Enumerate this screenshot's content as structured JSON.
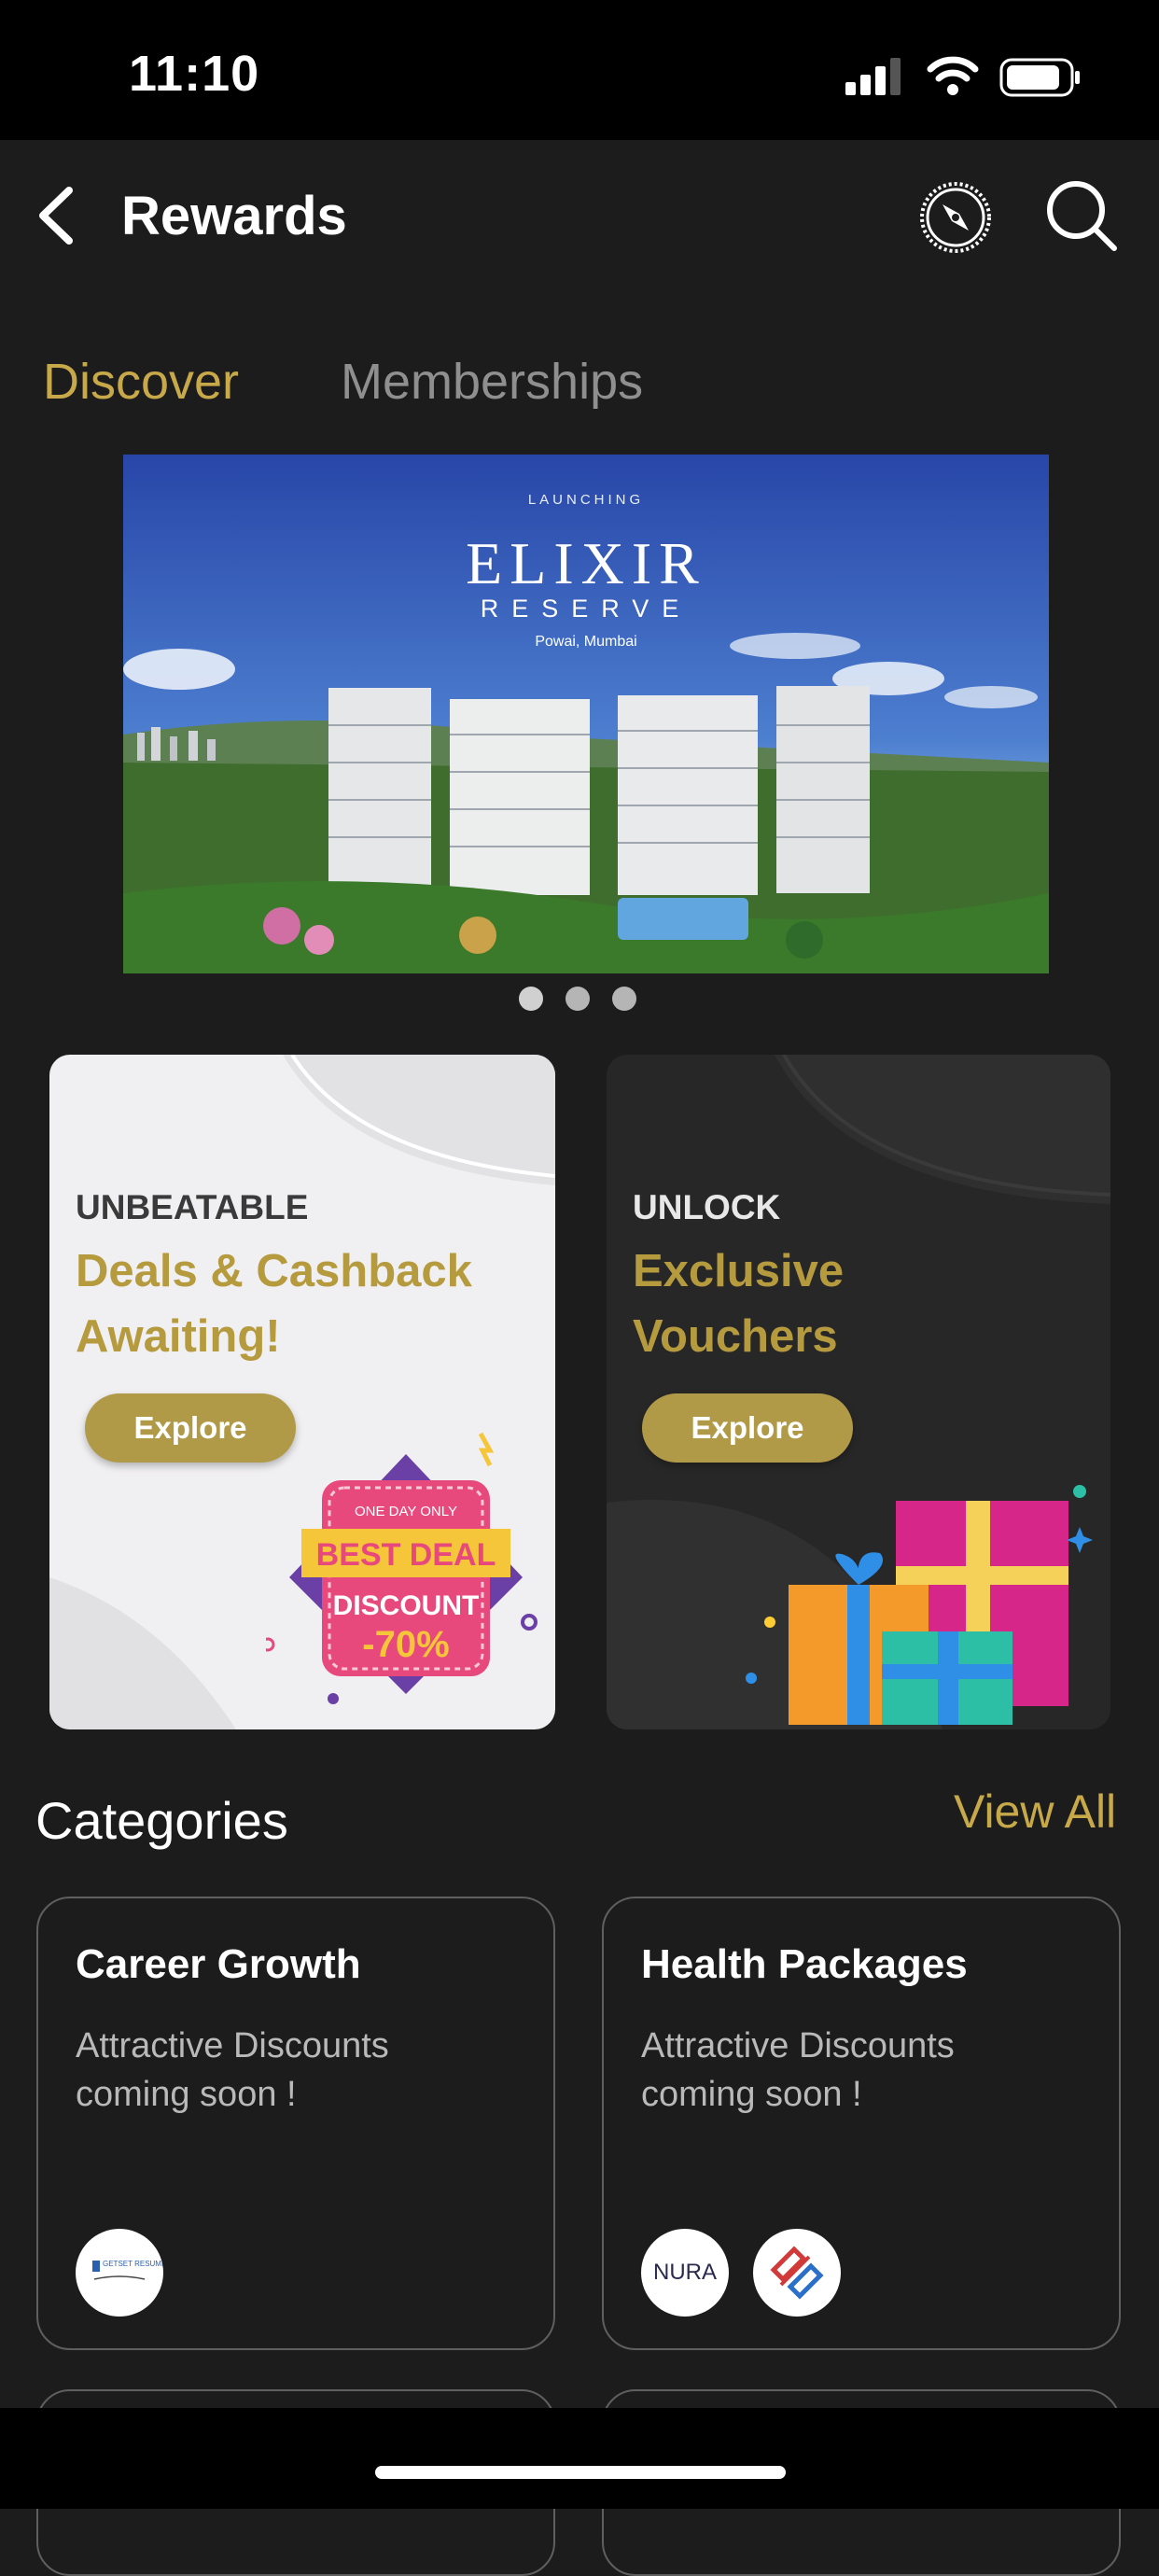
{
  "status_bar": {
    "time": "11:10"
  },
  "header": {
    "title": "Rewards"
  },
  "tabs": [
    {
      "label": "Discover",
      "active": true
    },
    {
      "label": "Memberships",
      "active": false
    }
  ],
  "banner": {
    "kicker": "LAUNCHING",
    "title": "ELIXIR",
    "subtitle": "RESERVE",
    "location": "Powai, Mumbai",
    "pages": 3,
    "current_page": 1
  },
  "promos": [
    {
      "kicker": "UNBEATABLE",
      "headline_line1": "Deals & Cashback",
      "headline_line2": "Awaiting!",
      "button": "Explore",
      "badge": {
        "top": "ONE DAY ONLY",
        "main": "BEST DEAL",
        "line": "DISCOUNT",
        "value": "-70%"
      }
    },
    {
      "kicker": "UNLOCK",
      "headline_line1": "Exclusive",
      "headline_line2": "Vouchers",
      "button": "Explore"
    }
  ],
  "categories": {
    "title": "Categories",
    "view_all": "View All",
    "items": [
      {
        "title": "Career Growth",
        "desc_line1": "Attractive Discounts",
        "desc_line2": "coming soon !",
        "logos": [
          "GETSET RESUMES"
        ]
      },
      {
        "title": "Health Packages",
        "desc_line1": "Attractive Discounts",
        "desc_line2": "coming soon !",
        "logos": [
          "NURA",
          "partner"
        ]
      }
    ]
  },
  "colors": {
    "accent": "#c8a94a",
    "background": "#1c1c1c",
    "button_gold": "#b19a47"
  }
}
